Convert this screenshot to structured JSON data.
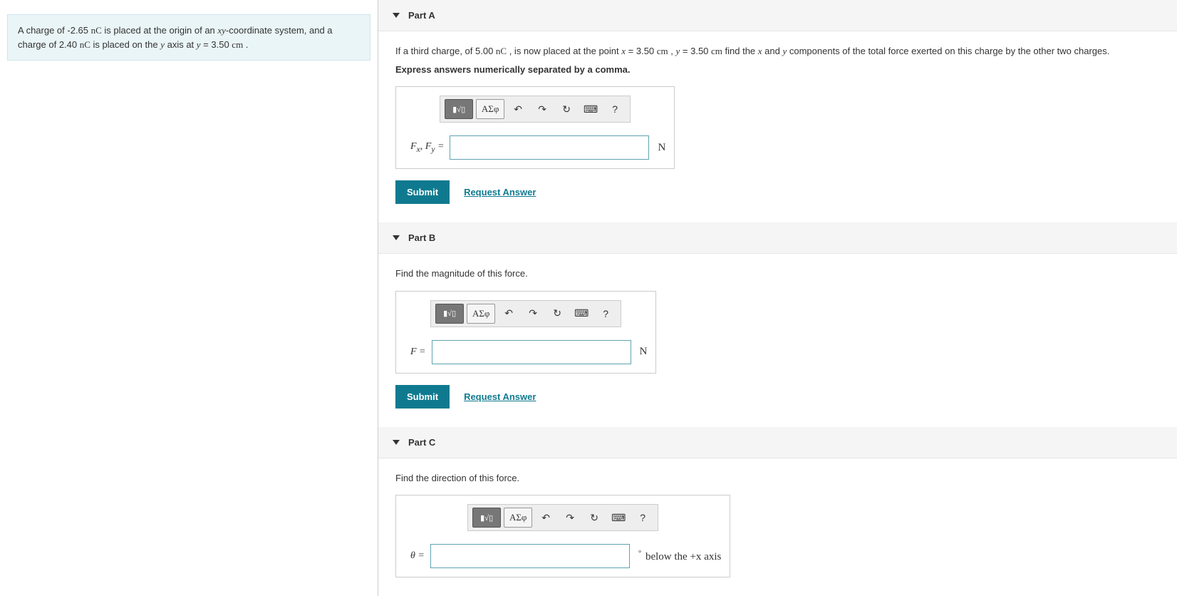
{
  "problem": {
    "text_a": "A charge of -2.65 ",
    "unit_nc": "nC",
    "text_b": " is placed at the origin of an ",
    "xy": "xy",
    "text_c": "-coordinate system, and a charge of 2.40 ",
    "text_d": " is placed on the ",
    "yvar": "y",
    "text_e": " axis at ",
    "yeq": "y",
    "text_f": " = 3.50 ",
    "cm": "cm",
    "text_g": " ."
  },
  "partA": {
    "header": "Part A",
    "l1_a": "If a third charge, of 5.00 ",
    "l1_nc": "nC",
    "l1_b": " , is now placed at the point ",
    "l1_x": "x",
    "l1_c": " = 3.50 ",
    "l1_cm1": "cm",
    "l1_d": " , ",
    "l1_y": "y",
    "l1_e": " = 3.50 ",
    "l1_cm2": "cm",
    "l1_f": " find the ",
    "l1_xc": "x",
    "l1_g": " and ",
    "l1_yc": "y",
    "l1_h": " components of the total force exerted on this charge by the other two charges.",
    "l2": "Express answers numerically separated by a comma.",
    "var_label": "Fₓ, Fᵧ =",
    "unit": "N",
    "submit": "Submit",
    "request": "Request Answer"
  },
  "partB": {
    "header": "Part B",
    "instr": "Find the magnitude of this force.",
    "var_label": "F =",
    "unit": "N",
    "submit": "Submit",
    "request": "Request Answer"
  },
  "partC": {
    "header": "Part C",
    "instr": "Find the direction of this force.",
    "var_label": "θ =",
    "deg": "°",
    "unit_a": " below the ",
    "unit_b": "+x",
    "unit_c": " axis"
  },
  "toolbar": {
    "fmt": "▮√▯",
    "greek": "ΑΣφ",
    "undo": "↶",
    "redo": "↷",
    "reset": "↻",
    "keyboard": "⌨",
    "help": "?"
  }
}
